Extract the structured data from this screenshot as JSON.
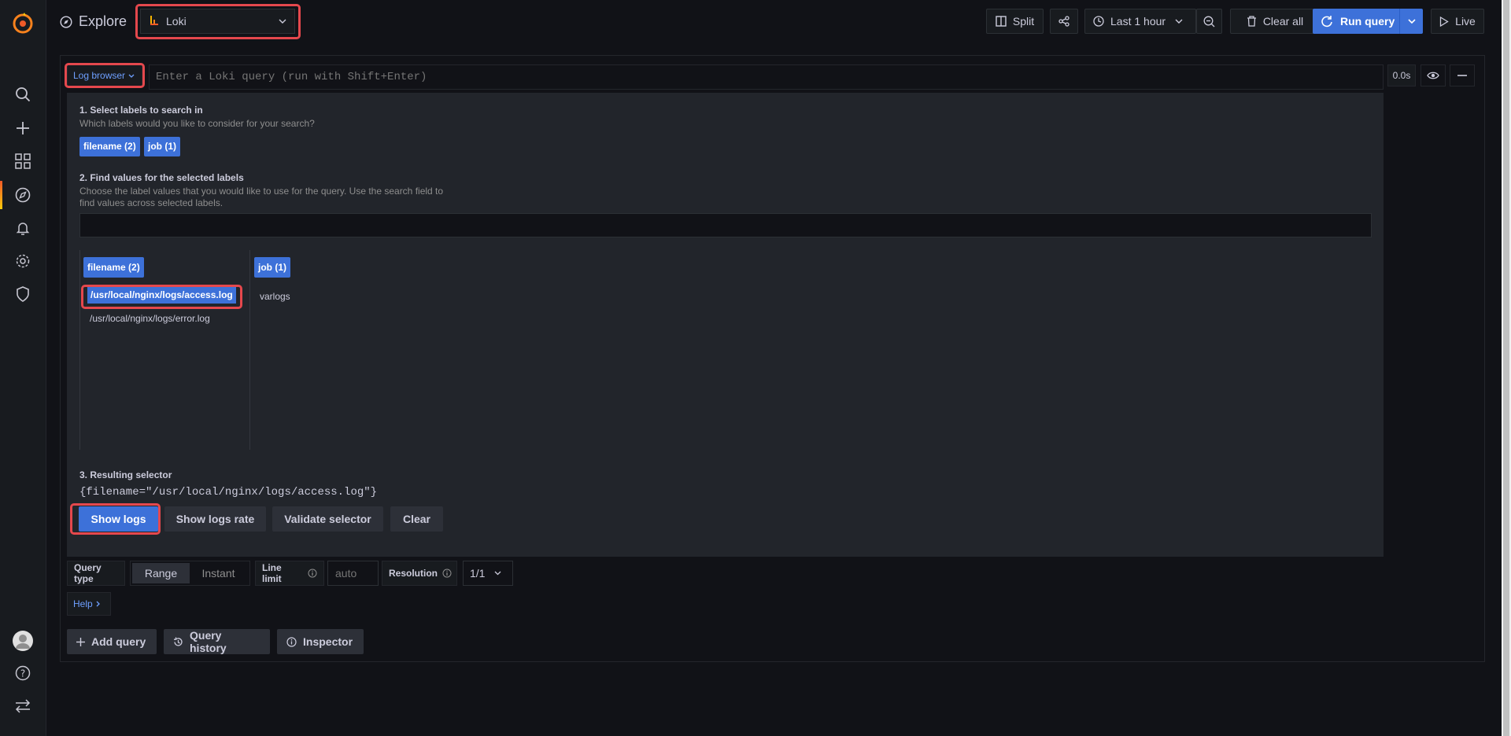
{
  "app": {
    "page_title": "Explore",
    "datasource": "Loki",
    "accent": "#3d71d9",
    "highlight": "#e5484d"
  },
  "toolbar": {
    "split_label": "Split",
    "time_label": "Last 1 hour",
    "clear_all_label": "Clear all",
    "run_query_label": "Run query",
    "live_label": "Live"
  },
  "query": {
    "log_browser_label": "Log browser",
    "placeholder": "Enter a Loki query (run with Shift+Enter)",
    "duration": "0.0s"
  },
  "browser": {
    "step1_title": "1. Select labels to search in",
    "step1_desc": "Which labels would you like to consider for your search?",
    "labels": [
      "filename (2)",
      "job (1)"
    ],
    "step2_title": "2. Find values for the selected labels",
    "step2_desc_line1": "Choose the label values that you would like to use for the query. Use the search field to",
    "step2_desc_line2": "find values across selected labels.",
    "search_value": "",
    "columns": [
      {
        "header": "filename (2)",
        "values": [
          "/usr/local/nginx/logs/access.log",
          "/usr/local/nginx/logs/error.log"
        ]
      },
      {
        "header": "job (1)",
        "values": [
          "varlogs"
        ]
      }
    ],
    "step3_title": "3. Resulting selector",
    "selector": "{filename=\"/usr/local/nginx/logs/access.log\"}",
    "show_logs": "Show logs",
    "show_logs_rate": "Show logs rate",
    "validate": "Validate selector",
    "clear": "Clear"
  },
  "options": {
    "query_type_label": "Query type",
    "range": "Range",
    "instant": "Instant",
    "line_limit_label": "Line limit",
    "line_limit_placeholder": "auto",
    "resolution_label": "Resolution",
    "resolution_value": "1/1",
    "help": "Help"
  },
  "bottom": {
    "add_query": "Add query",
    "query_history": "Query history",
    "inspector": "Inspector"
  }
}
